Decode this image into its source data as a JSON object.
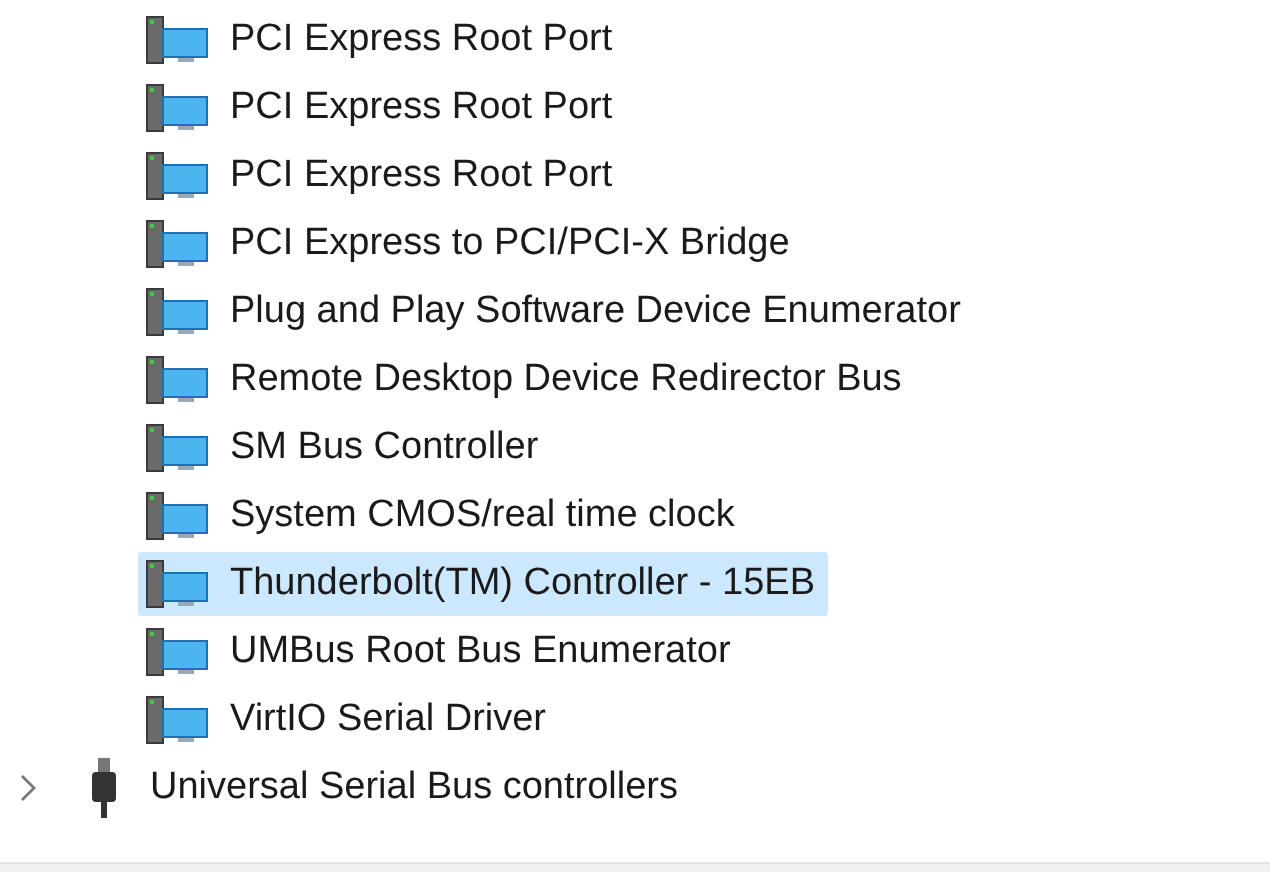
{
  "device_rows": [
    {
      "label": "PCI Express Root Port",
      "selected": false
    },
    {
      "label": "PCI Express Root Port",
      "selected": false
    },
    {
      "label": "PCI Express Root Port",
      "selected": false
    },
    {
      "label": "PCI Express to PCI/PCI-X Bridge",
      "selected": false
    },
    {
      "label": "Plug and Play Software Device Enumerator",
      "selected": false
    },
    {
      "label": "Remote Desktop Device Redirector Bus",
      "selected": false
    },
    {
      "label": "SM Bus Controller",
      "selected": false
    },
    {
      "label": "System CMOS/real time clock",
      "selected": false
    },
    {
      "label": "Thunderbolt(TM) Controller - 15EB",
      "selected": true
    },
    {
      "label": "UMBus Root Bus Enumerator",
      "selected": false
    },
    {
      "label": "VirtIO Serial Driver",
      "selected": false
    }
  ],
  "category_rows": [
    {
      "label": "Universal Serial Bus controllers",
      "expanded": false
    }
  ]
}
